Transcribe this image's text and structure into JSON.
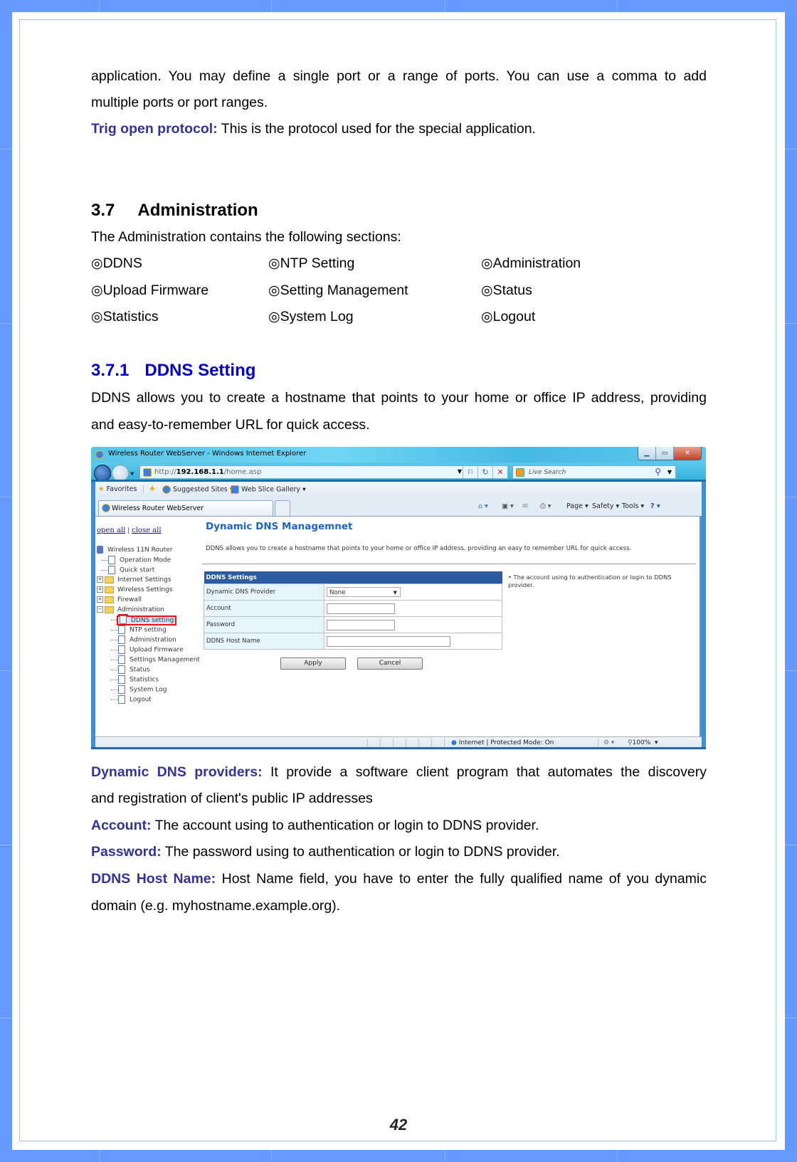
{
  "document": {
    "intro_lines": [
      "application. You may define a single port or a range of ports. You can use a comma to add",
      "multiple ports or port ranges."
    ],
    "trig_open_protocol": {
      "term": "Trig open protocol:",
      "text": " This is the protocol used for the special application."
    },
    "section": {
      "number": "3.7",
      "title": "Administration",
      "intro": "The Administration contains the following sections:",
      "bullet_symbol": "◎",
      "items": [
        "DDNS",
        "NTP Setting",
        "Administration",
        "Upload Firmware",
        "Setting Management",
        "Status",
        "Statistics",
        "System Log",
        "Logout"
      ]
    },
    "subsection": {
      "number": "3.7.1",
      "title": "DDNS Setting",
      "desc_lines": [
        "DDNS allows you to create a hostname that points to your home or office IP address, providing",
        "and easy-to-remember URL for quick access."
      ]
    },
    "definitions": [
      {
        "term": "Dynamic DNS providers:",
        "lines": [
          " It provide a software client program that automates the discovery",
          "and registration of client's public IP addresses"
        ]
      },
      {
        "term": "Account:",
        "lines": [
          " The account using to authentication or login to DDNS provider."
        ]
      },
      {
        "term": "Password:",
        "lines": [
          " The password using to authentication or login to DDNS provider."
        ]
      },
      {
        "term": "DDNS Host Name:",
        "lines": [
          " Host Name field, you have to enter the fully qualified name of you dynamic",
          "domain (e.g. myhostname.example.org)."
        ]
      }
    ],
    "page_number": "42",
    "colors": {
      "border_blue": "#6699ff",
      "term_color": "#333399",
      "subheading_color": "#0000cc"
    }
  },
  "screenshot": {
    "window_title": "Wireless Router WebServer - Windows Internet Explorer",
    "window_buttons": {
      "minimize": "▁",
      "maximize": "▭",
      "close": "✕"
    },
    "address": {
      "prefix": "http://",
      "host": "192.168.1.1",
      "path": "/home.asp"
    },
    "search_placeholder": "Live Search",
    "favorites_bar": {
      "favorites": "Favorites",
      "suggested_sites": "Suggested Sites ▾",
      "web_slice_gallery": "Web Slice Gallery ▾"
    },
    "tab_title": "Wireless Router WebServer",
    "command_bar": {
      "page": "Page ▾",
      "safety": "Safety ▾",
      "tools": "Tools ▾",
      "help": "? ▾"
    },
    "tree": {
      "open_all": "open all",
      "separator": "|",
      "close_all": "close all",
      "root": "Wireless 11N Router",
      "nodes": [
        {
          "label": "Operation Mode",
          "type": "doc",
          "level": 1
        },
        {
          "label": "Quick start",
          "type": "doc",
          "level": 1
        },
        {
          "label": "Internet Settings",
          "type": "folder",
          "level": 1
        },
        {
          "label": "Wireless Settings",
          "type": "folder",
          "level": 1
        },
        {
          "label": "Firewall",
          "type": "folder",
          "level": 1
        },
        {
          "label": "Administration",
          "type": "folder-open",
          "level": 1
        },
        {
          "label": "DDNS setting",
          "type": "doc",
          "level": 2,
          "selected": true
        },
        {
          "label": "NTP setting",
          "type": "doc",
          "level": 2
        },
        {
          "label": "Administration",
          "type": "doc",
          "level": 2
        },
        {
          "label": "Upload Firmware",
          "type": "doc",
          "level": 2
        },
        {
          "label": "Settings Management",
          "type": "doc",
          "level": 2
        },
        {
          "label": "Status",
          "type": "doc",
          "level": 2
        },
        {
          "label": "Statistics",
          "type": "doc",
          "level": 2
        },
        {
          "label": "System Log",
          "type": "doc",
          "level": 2
        },
        {
          "label": "Logout",
          "type": "doc",
          "level": 2
        }
      ]
    },
    "page_heading": "Dynamic DNS Managemnet",
    "page_intro": "DDNS allows you to create a hostname that points to your home or office IP address, providing an easy to remember URL for quick access.",
    "settings": {
      "header": "DDNS Settings",
      "rows": [
        {
          "label": "Dynamic DNS Provider",
          "type": "select",
          "value": "None"
        },
        {
          "label": "Account",
          "type": "text",
          "value": ""
        },
        {
          "label": "Password",
          "type": "password",
          "value": ""
        },
        {
          "label": "DDNS Host Name",
          "type": "text",
          "value": ""
        }
      ],
      "apply": "Apply",
      "cancel": "Cancel"
    },
    "help_text": "The account using to authentication or login to DDNS provider.",
    "status_bar": {
      "zone": "Internet | Protected Mode: On",
      "zoom": "100%"
    }
  }
}
